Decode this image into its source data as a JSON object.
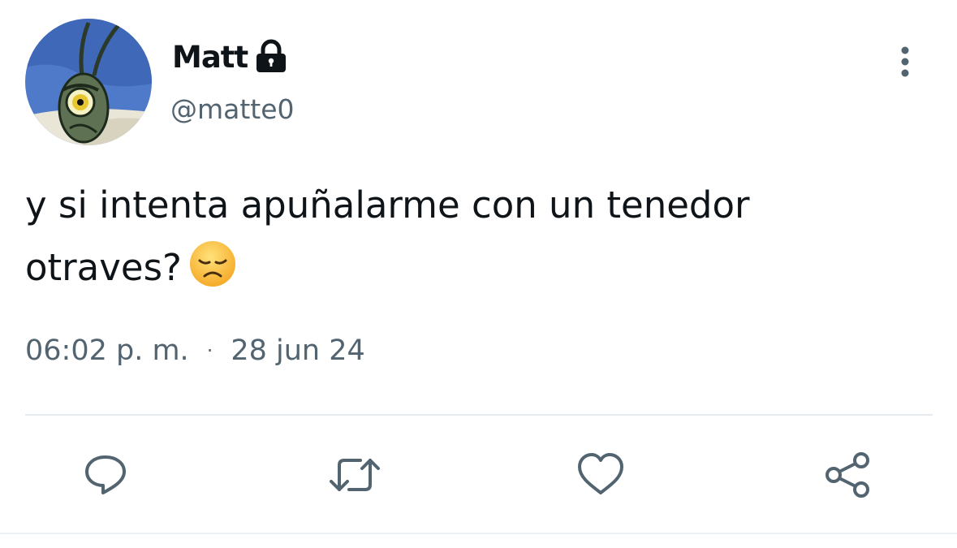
{
  "author": {
    "display_name": "Matt",
    "handle": "@matte0",
    "protected_icon": "lock-icon",
    "avatar": "plankton-avatar"
  },
  "tweet": {
    "text_line1": "y si intenta apuñalarme con un tenedor",
    "text_line2": "otraves?",
    "emoji": "disappointed-face-emoji"
  },
  "meta": {
    "time": "06:02 p. m.",
    "separator": "·",
    "date": "28 jun 24"
  },
  "actions": [
    {
      "icon": "reply-icon"
    },
    {
      "icon": "retweet-icon"
    },
    {
      "icon": "like-icon"
    },
    {
      "icon": "share-icon"
    }
  ],
  "colors": {
    "text_primary": "#0f1419",
    "text_secondary": "#536471",
    "divider": "#e7ebee"
  }
}
